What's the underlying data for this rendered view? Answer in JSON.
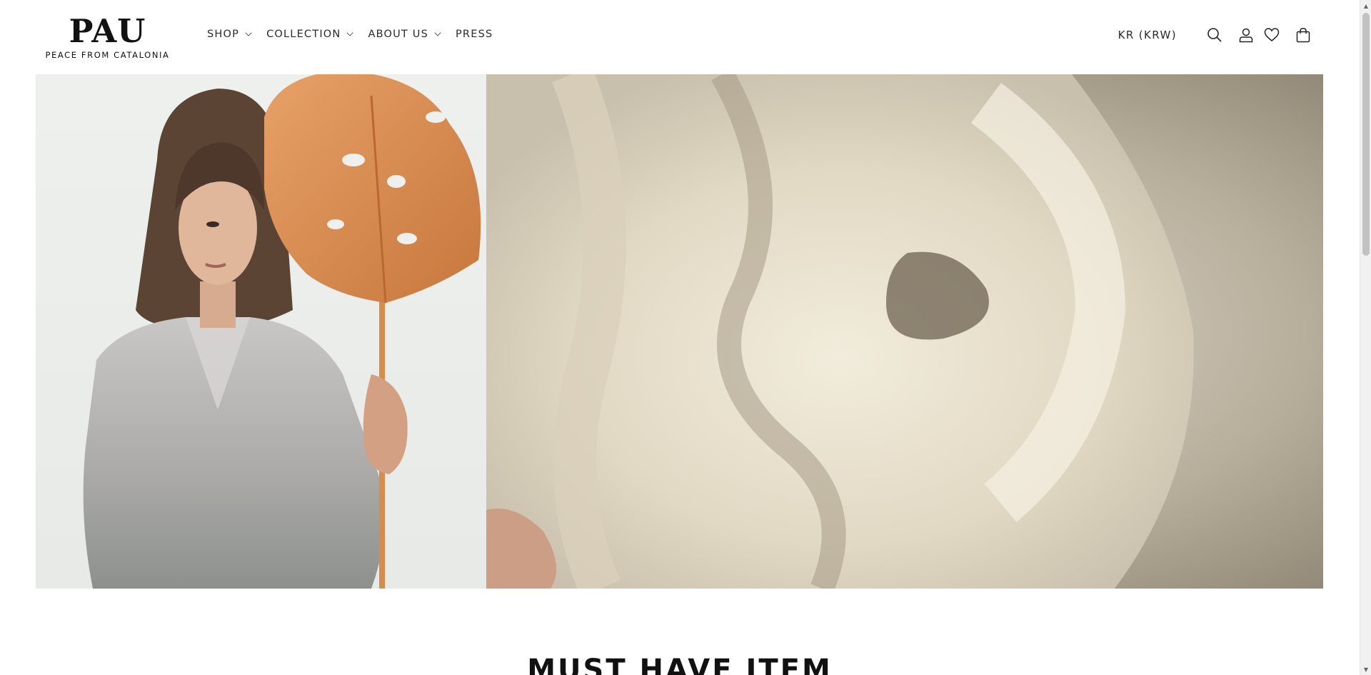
{
  "brand": {
    "name": "PAU",
    "tagline": "PEACE FROM CATALONIA"
  },
  "nav": {
    "items": [
      {
        "label": "SHOP",
        "has_dropdown": true
      },
      {
        "label": "COLLECTION",
        "has_dropdown": true
      },
      {
        "label": "ABOUT US",
        "has_dropdown": true
      },
      {
        "label": "PRESS",
        "has_dropdown": false
      }
    ]
  },
  "header": {
    "currency": "KR (KRW)",
    "icons": [
      "search-icon",
      "account-icon",
      "wishlist-icon",
      "cart-icon"
    ]
  },
  "hero": {
    "left_image": "model-with-monstera-leaf-photo",
    "right_image": "draped-silk-fabric-photo"
  },
  "section": {
    "title": "MUST HAVE ITEM"
  },
  "colors": {
    "text": "#1a1a1a",
    "leaf": "#d98a4a",
    "background": "#ffffff"
  }
}
